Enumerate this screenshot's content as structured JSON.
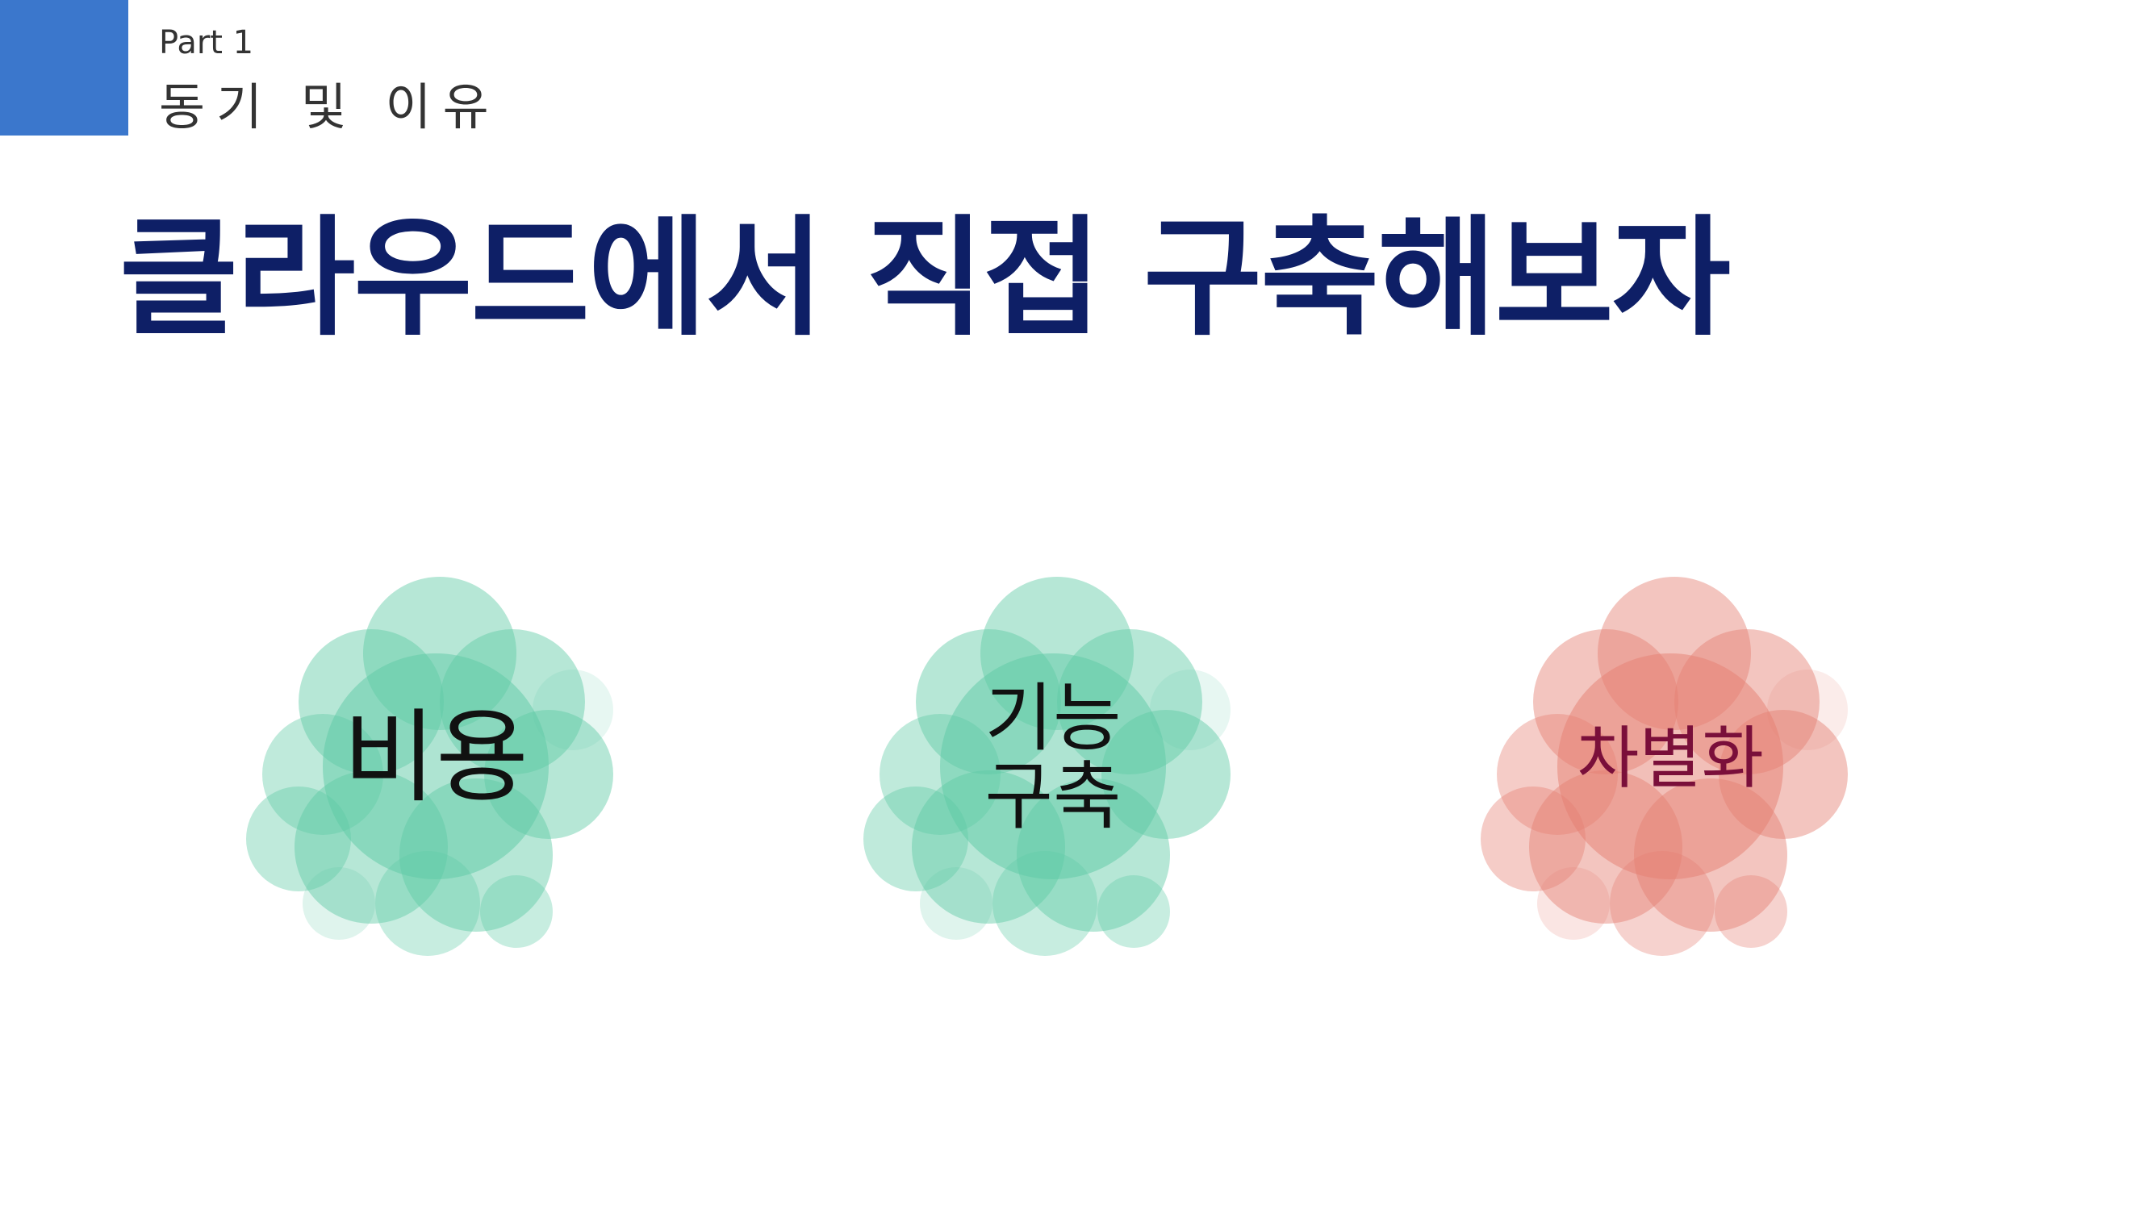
{
  "header": {
    "part": "Part 1",
    "section": "동기 및 이유"
  },
  "title": "클라우드에서 직접 구축해보자",
  "colors": {
    "accent": "#3b77cc",
    "title": "#0e1f66",
    "green_blob": "#5ecaa5",
    "red_blob": "#e57f72",
    "text_dark": "#111111",
    "text_maroon": "#7a0f3a"
  },
  "items": [
    {
      "lines": [
        "비용"
      ],
      "color": "green"
    },
    {
      "lines": [
        "기능",
        "구축"
      ],
      "color": "green"
    },
    {
      "lines": [
        "차별화"
      ],
      "color": "red"
    }
  ]
}
